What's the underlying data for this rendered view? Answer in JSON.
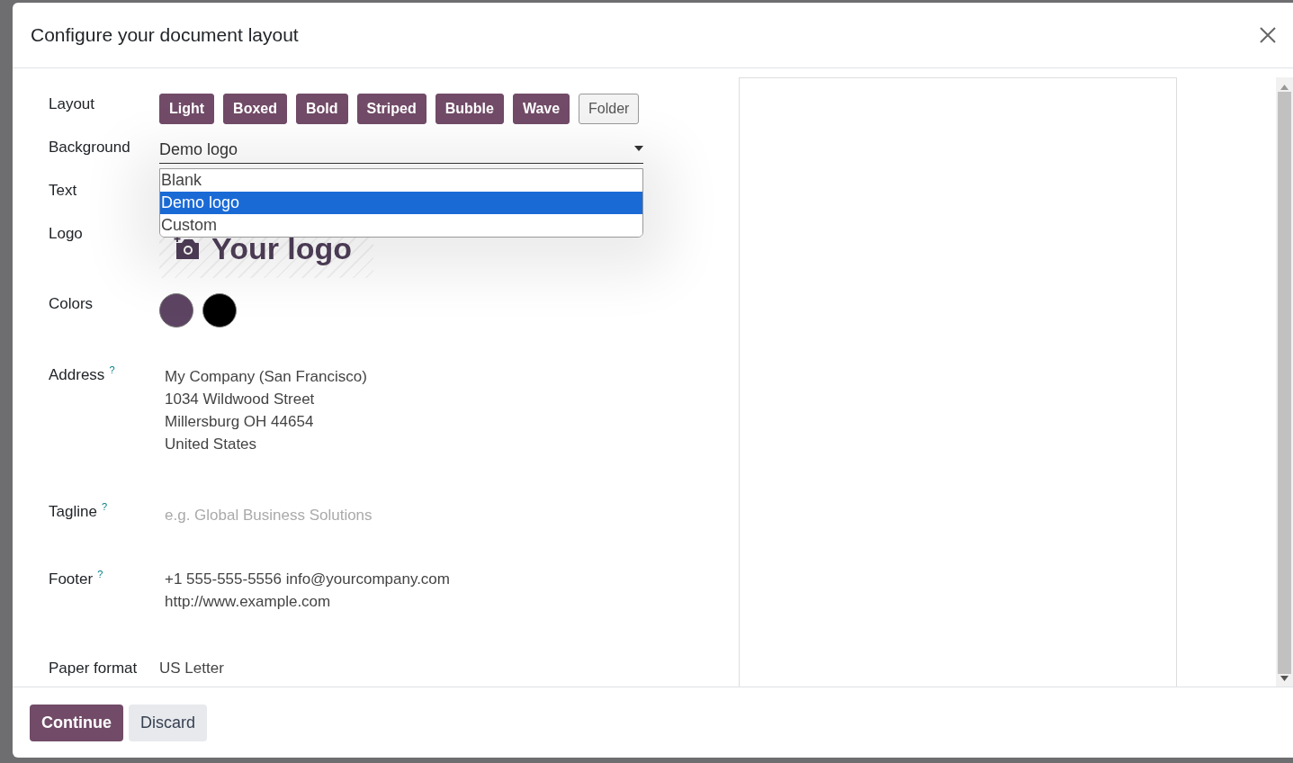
{
  "dialog": {
    "title": "Configure your document layout"
  },
  "layout": {
    "label": "Layout",
    "options": [
      {
        "label": "Light",
        "selected": false
      },
      {
        "label": "Boxed",
        "selected": false
      },
      {
        "label": "Bold",
        "selected": false
      },
      {
        "label": "Striped",
        "selected": false
      },
      {
        "label": "Bubble",
        "selected": false
      },
      {
        "label": "Wave",
        "selected": false
      },
      {
        "label": "Folder",
        "selected": true
      }
    ]
  },
  "background": {
    "label": "Background",
    "value": "Demo logo",
    "expanded": true,
    "options": [
      {
        "label": "Blank",
        "selected": false
      },
      {
        "label": "Demo logo",
        "selected": true
      },
      {
        "label": "Custom",
        "selected": false
      }
    ]
  },
  "text": {
    "label": "Text"
  },
  "logo": {
    "label": "Logo",
    "placeholder": "Your logo"
  },
  "colors": {
    "label": "Colors",
    "swatches": [
      {
        "color": "#5e4463"
      },
      {
        "color": "#000000"
      }
    ]
  },
  "address": {
    "label": "Address",
    "help": "?",
    "lines": [
      "My Company (San Francisco)",
      "1034 Wildwood Street",
      "Millersburg OH 44654",
      "United States"
    ]
  },
  "tagline": {
    "label": "Tagline",
    "help": "?",
    "placeholder": "e.g. Global Business Solutions"
  },
  "footer": {
    "label": "Footer",
    "help": "?",
    "lines": [
      "+1 555-555-5556 info@yourcompany.com",
      "http://www.example.com"
    ]
  },
  "paper_format": {
    "label": "Paper format",
    "value": "US Letter"
  },
  "buttons": [
    {
      "label": "Continue",
      "kind": "primary"
    },
    {
      "label": "Discard",
      "kind": "secondary"
    }
  ]
}
